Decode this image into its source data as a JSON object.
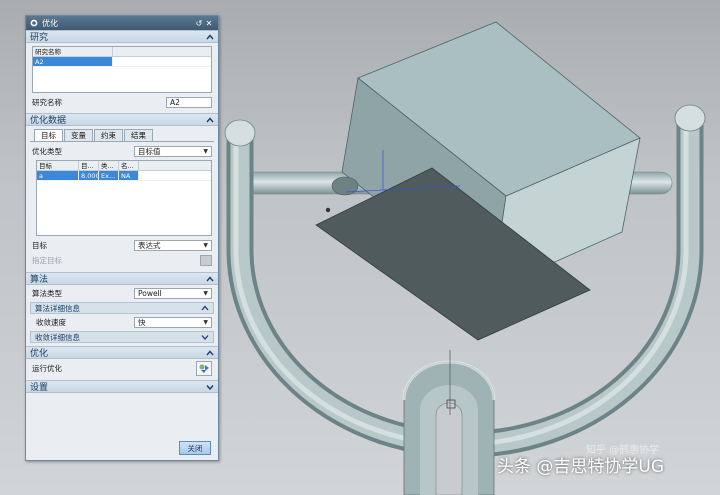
{
  "dialog": {
    "title": "优化",
    "study": {
      "header": "研究",
      "table_header": "研究名称",
      "rows": [
        "A2"
      ],
      "name_label": "研究名称",
      "name_value": "A2"
    },
    "opt_data": {
      "header": "优化数据",
      "tabs": [
        "目标",
        "变量",
        "约束",
        "结果"
      ],
      "type_label": "优化类型",
      "type_value": "目标值",
      "table_headers": [
        "目标",
        "目...",
        "类...",
        "名..."
      ],
      "rows": [
        [
          "a",
          "8.000",
          "Ex...",
          "NA"
        ]
      ],
      "target_label": "目标",
      "target_value": "表达式",
      "specify_label": "指定目标"
    },
    "algorithm": {
      "header": "算法",
      "type_label": "算法类型",
      "type_value": "Powell",
      "detail_header": "算法详细信息",
      "speed_label": "收敛速度",
      "speed_value": "快",
      "conv_header": "收敛详细信息"
    },
    "optimize": {
      "header": "优化",
      "run_label": "运行优化"
    },
    "settings": {
      "header": "设置"
    },
    "close_label": "关闭"
  },
  "watermark": "头条 @吉思特协学UG",
  "faint_mark": "知乎 @鹤惠协学"
}
